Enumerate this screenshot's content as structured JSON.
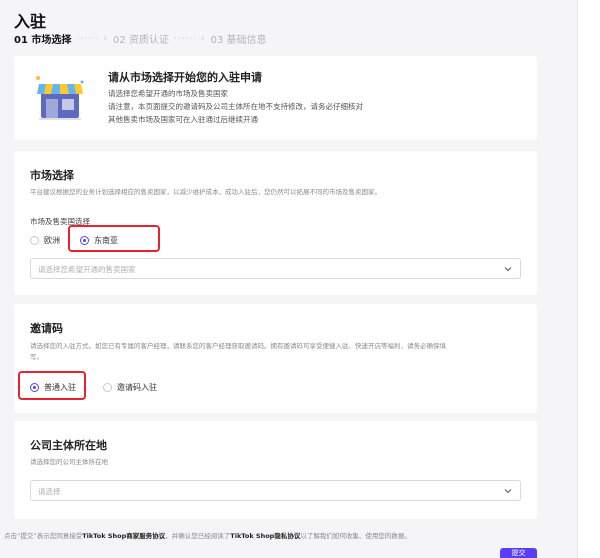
{
  "page": {
    "title": "入驻"
  },
  "steps": [
    {
      "label": "01 市场选择"
    },
    {
      "label": "02 资质认证"
    },
    {
      "label": "03 基础信息"
    }
  ],
  "intro": {
    "title": "请从市场选择开始您的入驻申请",
    "line1": "请选择您希望开通的市场及售卖国家",
    "line2": "请注意，本页面提交的邀请码及公司主体所在地不支持修改，请务必仔细核对",
    "line3": "其他售卖市场及国家可在入驻通过后继续开通"
  },
  "market": {
    "title": "市场选择",
    "description": "平台建议根据您的业务计划选择相应的售卖国家，以减少维护成本，成功入驻后，您仍然可以拓展不同的市场及售卖国家。",
    "field_label": "市场及售卖国选择",
    "options": [
      {
        "label": "欧洲",
        "checked": false
      },
      {
        "label": "东南亚",
        "checked": true
      }
    ],
    "select_placeholder": "请选择您希望开通的售卖国家"
  },
  "invite": {
    "title": "邀请码",
    "description_line1": "请选择您的入驻方式。如您已有专属的客户经理，请联系您的客户经理获取邀请码。拥有邀请码可享受便捷入驻、快速开店等福利，请务必确保填",
    "description_line2": "写。",
    "options": [
      {
        "label": "普通入驻",
        "checked": true
      },
      {
        "label": "邀请码入驻",
        "checked": false
      }
    ]
  },
  "company": {
    "title": "公司主体所在地",
    "description": "请选择您的公司主体所在地",
    "select_placeholder": "请选择"
  },
  "footer": {
    "prefix": "点击“提交”表示您同意接受",
    "agreement_link": "TikTok Shop商家服务协议",
    "middle": "，并确认您已经阅读了",
    "privacy_link": "TikTok Shop隐私协议",
    "suffix": "以了解我们如何收集、使用您的数据。",
    "submit_label": "提交"
  },
  "colors": {
    "accent": "#5b3df6",
    "highlight": "#e8222f"
  }
}
